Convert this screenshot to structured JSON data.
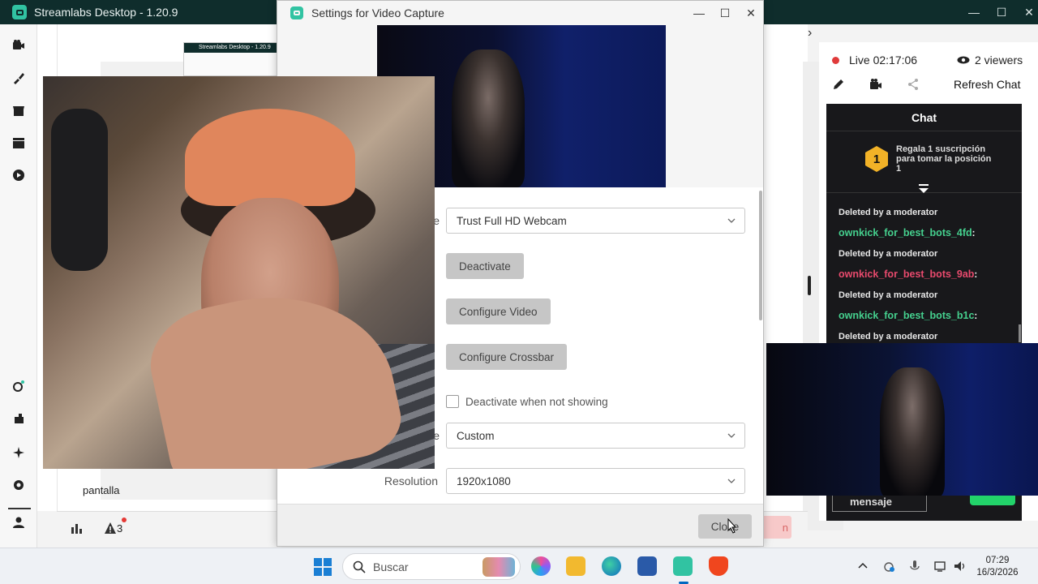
{
  "app": {
    "title": "Streamlabs Desktop - 1.20.9",
    "mini_title": "Streamlabs Desktop - 1.20.9"
  },
  "editor": {
    "scene_label": "pantalla",
    "warning_count": "3",
    "go_live_partial": "n"
  },
  "live": {
    "status": "Live 02:17:06",
    "viewers": "2 viewers",
    "refresh_chat": "Refresh Chat"
  },
  "chat": {
    "header": "Chat",
    "gift_rank": "1",
    "gift_text": "Regala 1 suscripción para tomar la posición 1",
    "messages": [
      {
        "text": "Deleted by a moderator"
      },
      {
        "user": "ownkick_for_best_bots_4fd",
        "sep": ":",
        "text": "Deleted by a moderator"
      },
      {
        "user": "ownkick_for_best_bots_9ab",
        "sep": ":",
        "text": "Deleted by a moderator"
      },
      {
        "user": "ownkick_for_best_bots_b1c",
        "sep": ":",
        "text": "Deleted by a moderator"
      }
    ],
    "input_partial": "mensaje"
  },
  "dialog": {
    "title": "Settings for Video Capture",
    "device_label_partial": "e",
    "device_value": "Trust Full HD Webcam",
    "deactivate_button": "Deactivate",
    "configure_video_button": "Configure Video",
    "configure_crossbar_button": "Configure Crossbar",
    "deactivate_when_not_showing": "Deactivate when not showing",
    "preset_label_partial": "e",
    "preset_value": "Custom",
    "resolution_label": "Resolution",
    "resolution_value": "1920x1080",
    "close_button": "Close"
  },
  "taskbar": {
    "search_placeholder": "Buscar",
    "time": "07:29",
    "date": "16/3/2026"
  },
  "colors": {
    "brand_teal": "#31c3a2",
    "title_dark": "#0f2d2c",
    "chat_bg": "#18181b",
    "live_red": "#e03a3a",
    "user_green": "#45d08e",
    "user_red": "#e84a6d"
  },
  "icons": [
    "camera-icon",
    "paint-icon",
    "store-icon",
    "clapper-icon",
    "play-circle-icon",
    "link-icon",
    "settings-gear-icon",
    "sparkle-icon",
    "person-icon",
    "bar-chart-icon",
    "warning-icon",
    "pencil-icon",
    "share-icon",
    "eye-icon",
    "chevron-down-icon"
  ]
}
